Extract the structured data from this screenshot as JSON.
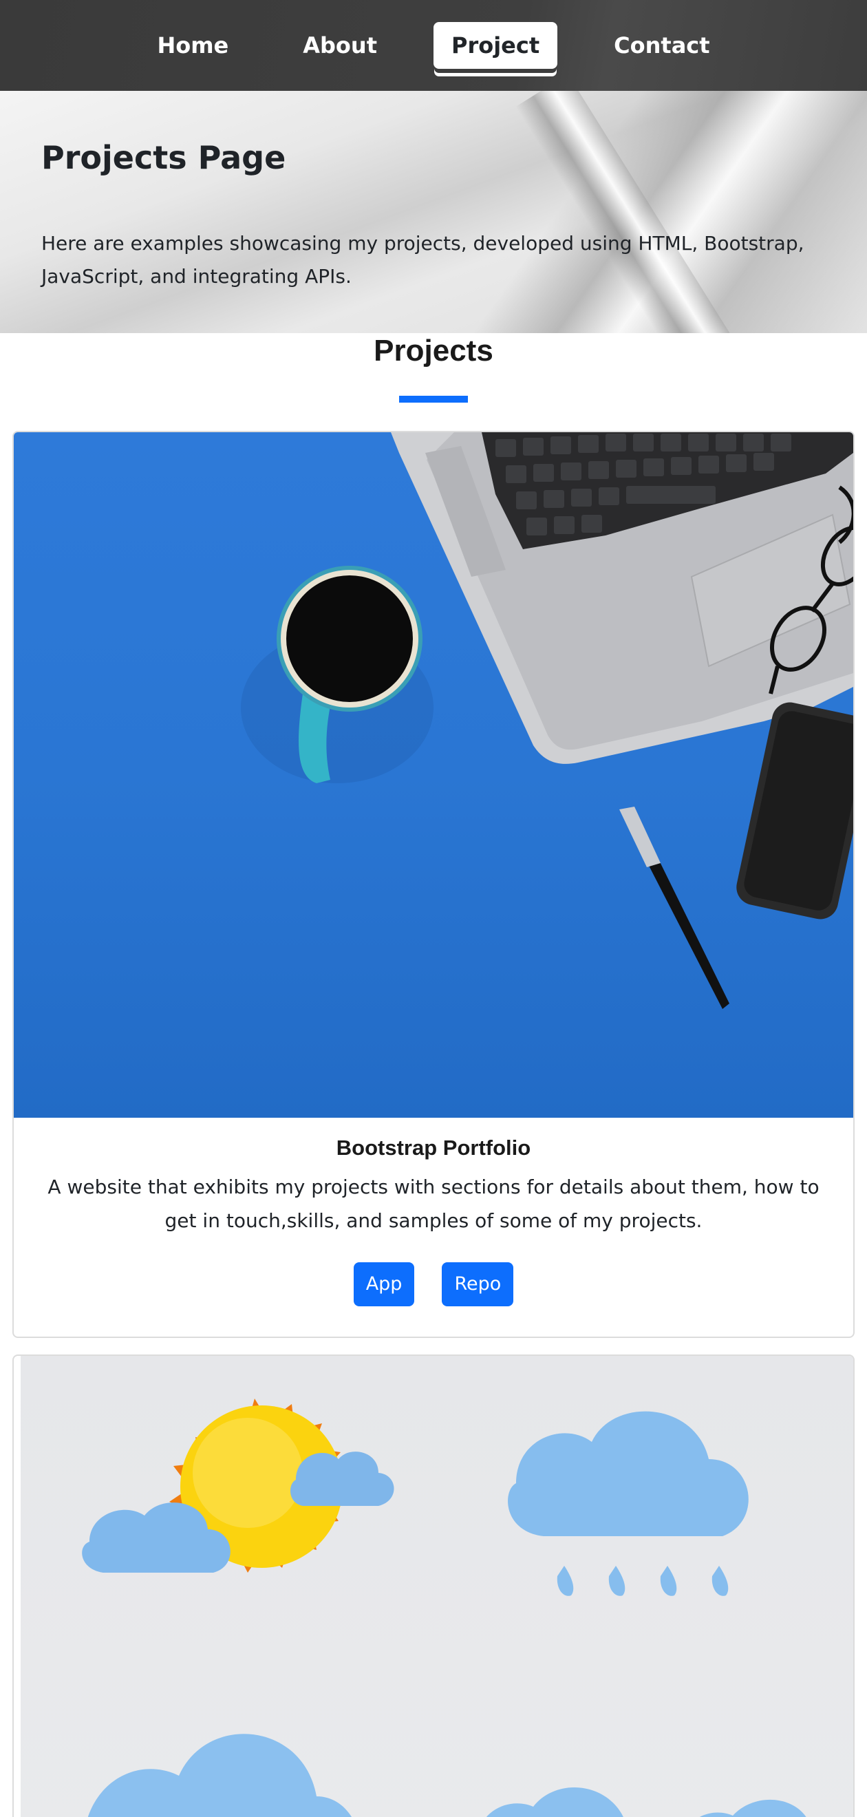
{
  "nav": {
    "items": [
      {
        "label": "Home"
      },
      {
        "label": "About"
      },
      {
        "label": "Project"
      },
      {
        "label": "Contact"
      }
    ],
    "active": "Project"
  },
  "banner": {
    "title": "Projects Page",
    "description": "Here are examples showcasing my projects, developed using HTML, Bootstrap, JavaScript, and integrating APIs."
  },
  "section": {
    "title": "Projects",
    "accent_color": "#0d6efd"
  },
  "projects": [
    {
      "image": "desk-laptop-coffee-photo",
      "title": "Bootstrap Portfolio",
      "description": "A website that exhibits my projects with sections for details about them, how to get in touch,skills, and samples of some of my projects.",
      "app_label": "App",
      "repo_label": "Repo"
    },
    {
      "image": "weather-icons-photo"
    }
  ],
  "colors": {
    "nav_bg": "#3d3d3d",
    "button": "#0d6efd",
    "desk_blue": "#2a76d3"
  }
}
